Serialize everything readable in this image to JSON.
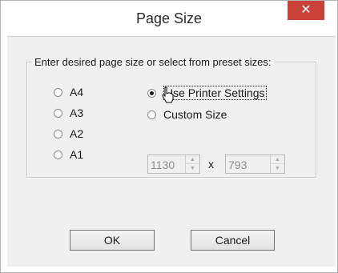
{
  "window": {
    "title": "Page Size",
    "close_label": "✕"
  },
  "group": {
    "legend": "Enter desired page size or select from preset sizes:"
  },
  "presets": [
    {
      "label": "A4",
      "checked": false
    },
    {
      "label": "A3",
      "checked": false
    },
    {
      "label": "A2",
      "checked": false
    },
    {
      "label": "A1",
      "checked": false
    }
  ],
  "options": {
    "printer": {
      "label": "Use Printer Settings",
      "checked": true
    },
    "custom": {
      "label": "Custom Size",
      "checked": false
    }
  },
  "size": {
    "width": "1130",
    "times": "x",
    "height": "793"
  },
  "buttons": {
    "ok": "OK",
    "cancel": "Cancel"
  },
  "colors": {
    "close_button": "#c94139",
    "disabled_text": "#8c8c8c"
  },
  "icons": {
    "close": "close-icon",
    "cursor": "mouse-pointer-icon",
    "spin_up": "spin-up-icon",
    "spin_down": "spin-down-icon"
  }
}
